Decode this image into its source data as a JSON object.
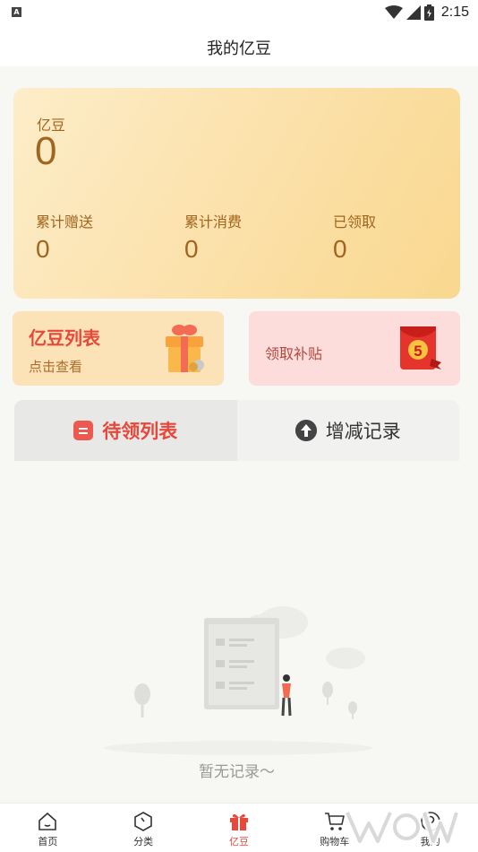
{
  "status_bar": {
    "app_badge": "A",
    "time": "2:15"
  },
  "header": {
    "title": "我的亿豆"
  },
  "balance": {
    "label": "亿豆",
    "value": "0",
    "stats": [
      {
        "label": "累计赠送",
        "value": "0"
      },
      {
        "label": "累计消费",
        "value": "0"
      },
      {
        "label": "已领取",
        "value": "0"
      }
    ]
  },
  "promos": {
    "left": {
      "title": "亿豆列表",
      "subtitle": "点击查看",
      "icon": "gift-box-icon"
    },
    "right": {
      "title": "领取补贴",
      "icon": "red-packet-icon",
      "badge": "5"
    }
  },
  "tabs": [
    {
      "label": "待领列表",
      "active": true,
      "icon": "list-icon"
    },
    {
      "label": "增减记录",
      "active": false,
      "icon": "arrow-up-circle-icon"
    }
  ],
  "empty_state": {
    "text": "暂无记录～"
  },
  "bottom_nav": [
    {
      "label": "首页",
      "icon": "home-icon",
      "active": false
    },
    {
      "label": "分类",
      "icon": "category-icon",
      "active": false
    },
    {
      "label": "亿豆",
      "icon": "gift-icon",
      "active": true
    },
    {
      "label": "购物车",
      "icon": "cart-icon",
      "active": false
    },
    {
      "label": "我的",
      "icon": "profile-icon",
      "active": false
    }
  ],
  "colors": {
    "accent": "#e8483b",
    "gold_text": "#a0651f",
    "card_bg": "#fbe0a8"
  }
}
